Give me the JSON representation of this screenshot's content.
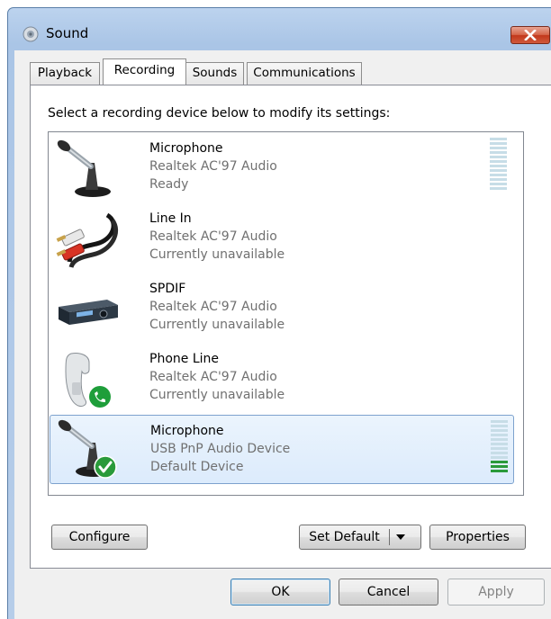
{
  "window": {
    "title": "Sound"
  },
  "tabs": [
    {
      "label": "Playback"
    },
    {
      "label": "Recording"
    },
    {
      "label": "Sounds"
    },
    {
      "label": "Communications"
    }
  ],
  "active_tab": "Recording",
  "instruction": "Select a recording device below to modify its settings:",
  "devices": [
    {
      "name": "Microphone",
      "driver": "Realtek AC'97 Audio",
      "status": "Ready",
      "icon": "microphone-icon",
      "level": 0
    },
    {
      "name": "Line In",
      "driver": "Realtek AC'97 Audio",
      "status": "Currently unavailable",
      "icon": "line-in-cable-icon"
    },
    {
      "name": "SPDIF",
      "driver": "Realtek AC'97 Audio",
      "status": "Currently unavailable",
      "icon": "spdif-device-icon"
    },
    {
      "name": "Phone Line",
      "driver": "Realtek AC'97 Audio",
      "status": "Currently unavailable",
      "icon": "phone-handset-icon"
    },
    {
      "name": "Microphone",
      "driver": "USB PnP Audio Device",
      "status": "Default Device",
      "icon": "microphone-icon",
      "level": 0.25,
      "selected": true,
      "default_badge": "green-checkmark-icon"
    }
  ],
  "buttons": {
    "configure": "Configure",
    "set_default": "Set Default",
    "properties": "Properties",
    "ok": "OK",
    "cancel": "Cancel",
    "apply": "Apply"
  },
  "colors": {
    "titlebar": "#b6cde9",
    "close_button": "#c2381b",
    "selection": "#dcebfc",
    "level_lit": "#2a9a3a",
    "level_unlit": "#c7dde7"
  }
}
